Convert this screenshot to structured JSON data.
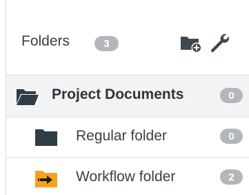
{
  "panel": {
    "title": "Folders",
    "count": "3",
    "actions": {
      "add_folder_icon": "add-folder-icon",
      "settings_icon": "wrench-icon"
    }
  },
  "folders": [
    {
      "label": "Project Documents",
      "count": "0",
      "icon": "open-folder-icon",
      "selected": true
    },
    {
      "label": "Regular folder",
      "count": "0",
      "icon": "folder-icon",
      "selected": false
    },
    {
      "label": "Workflow folder",
      "count": "2",
      "icon": "workflow-folder-icon",
      "selected": false
    }
  ],
  "colors": {
    "text": "#3a4047",
    "badge": "#b3b7bb",
    "folder_dark": "#2f3d44",
    "workflow_orange": "#f7a21b",
    "divider": "#d9dcdf"
  }
}
